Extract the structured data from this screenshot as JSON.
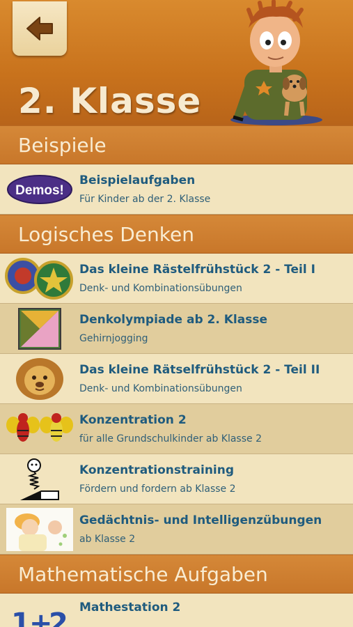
{
  "header": {
    "title": "2. Klasse",
    "back_icon": "arrow-left-icon",
    "colors": {
      "header_bg": "#c8721c",
      "title": "#f7ead0"
    }
  },
  "sections": [
    {
      "label": "Beispiele",
      "items": [
        {
          "icon": "demos-badge-icon",
          "badge_text": "Demos!",
          "title": "Beispielaufgaben",
          "subtitle": "Für Kinder ab der 2. Klasse"
        }
      ]
    },
    {
      "label": "Logisches Denken",
      "items": [
        {
          "icon": "puzzle-circles-icon",
          "title": "Das kleine Rästelfrühstück 2 - Teil I",
          "subtitle": "Denk- und Kombinationsübungen"
        },
        {
          "icon": "tangram-icon",
          "title": "Denkolympiade ab 2. Klasse",
          "subtitle": "Gehirnjogging"
        },
        {
          "icon": "lion-icon",
          "title": "Das kleine Rätselfrühstück 2 - Teil II",
          "subtitle": "Denk- und Kombinationsübungen"
        },
        {
          "icon": "bees-icon",
          "title": "Konzentration 2",
          "subtitle": "für alle Grundschulkinder ab Klasse 2"
        },
        {
          "icon": "spring-figure-icon",
          "title": "Konzentrationstraining",
          "subtitle": "Fördern und fordern ab Klasse 2"
        },
        {
          "icon": "kid-illustration-icon",
          "title": "Gedächtnis- und Intelligenzübungen",
          "subtitle": "ab Klasse 2"
        }
      ]
    },
    {
      "label": "Mathematische Aufgaben",
      "items": [
        {
          "icon": "one-plus-two-icon",
          "title": "Mathestation 2",
          "subtitle": ""
        }
      ]
    }
  ]
}
